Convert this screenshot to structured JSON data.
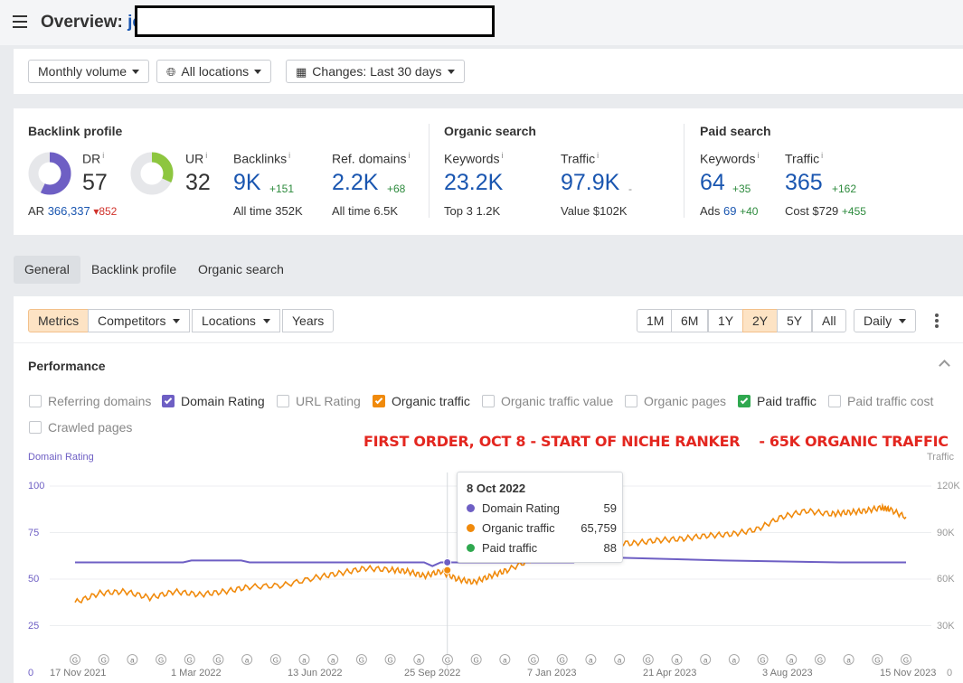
{
  "header": {
    "title": "Overview:",
    "domain_visible": "je"
  },
  "filters": {
    "volume": "Monthly volume",
    "locations": "All locations",
    "changes": "Changes: Last 30 days"
  },
  "backlink_profile": {
    "title": "Backlink profile",
    "dr": {
      "label": "DR",
      "value": "57",
      "fraction": 0.57
    },
    "ur": {
      "label": "UR",
      "value": "32",
      "fraction": 0.32
    },
    "ar_label": "AR",
    "ar_value": "366,337",
    "ar_delta": "▾852",
    "backlinks": {
      "label": "Backlinks",
      "value": "9K",
      "delta": "+151",
      "sub_label": "All time",
      "sub_value": "352K"
    },
    "ref_domains": {
      "label": "Ref. domains",
      "value": "2.2K",
      "delta": "+68",
      "sub_label": "All time",
      "sub_value": "6.5K"
    }
  },
  "organic_search": {
    "title": "Organic search",
    "keywords": {
      "label": "Keywords",
      "value": "23.2K",
      "sub_label": "Top 3",
      "sub_value": "1.2K"
    },
    "traffic": {
      "label": "Traffic",
      "value": "97.9K",
      "delta": "-",
      "sub_label": "Value",
      "sub_value": "$102K"
    }
  },
  "paid_search": {
    "title": "Paid search",
    "keywords": {
      "label": "Keywords",
      "value": "64",
      "delta": "+35",
      "sub_label": "Ads",
      "sub_value": "69",
      "sub_delta": "+40"
    },
    "traffic": {
      "label": "Traffic",
      "value": "365",
      "delta": "+162",
      "sub_label": "Cost",
      "sub_value": "$729",
      "sub_delta": "+455"
    }
  },
  "info_mark": "i",
  "tabs": [
    "General",
    "Backlink profile",
    "Organic search"
  ],
  "toolbar": {
    "metrics": "Metrics",
    "competitors": "Competitors",
    "locations": "Locations",
    "years": "Years",
    "ranges": [
      "1M",
      "6M",
      "1Y",
      "2Y",
      "5Y",
      "All"
    ],
    "active_range": "2Y",
    "interval": "Daily"
  },
  "performance": {
    "title": "Performance",
    "checkboxes": [
      {
        "label": "Referring domains",
        "checked": false
      },
      {
        "label": "Domain Rating",
        "checked": true,
        "color": "#6e5fc4"
      },
      {
        "label": "URL Rating",
        "checked": false
      },
      {
        "label": "Organic traffic",
        "checked": true,
        "color": "#f08a0c"
      },
      {
        "label": "Organic traffic value",
        "checked": false
      },
      {
        "label": "Organic pages",
        "checked": false
      },
      {
        "label": "Paid traffic",
        "checked": true,
        "color": "#2fa84f"
      },
      {
        "label": "Paid traffic cost",
        "checked": false
      },
      {
        "label": "Crawled pages",
        "checked": false
      }
    ],
    "annotation": "FIRST ORDER, OCT 8 - START OF NICHE RANKER    - 65K ORGANIC TRAFFIC"
  },
  "tooltip": {
    "date": "8 Oct 2022",
    "rows": [
      {
        "label": "Domain Rating",
        "value": "59",
        "color": "#6e5fc4"
      },
      {
        "label": "Organic traffic",
        "value": "65,759",
        "color": "#f08a0c"
      },
      {
        "label": "Paid traffic",
        "value": "88",
        "color": "#2fa84f"
      }
    ]
  },
  "chart_data": {
    "type": "line",
    "left_axis_label": "Domain Rating",
    "right_axis_label": "Traffic",
    "left_ticks": [
      "100",
      "75",
      "50",
      "25",
      "0"
    ],
    "right_ticks": [
      "120K",
      "90K",
      "60K",
      "30K",
      "0"
    ],
    "x_ticks": [
      "17 Nov 2021",
      "1 Mar 2022",
      "13 Jun 2022",
      "25 Sep 2022",
      "7 Jan 2023",
      "21 Apr 2023",
      "3 Aug 2023",
      "15 Nov 2023"
    ],
    "ylim_left": [
      0,
      100
    ],
    "ylim_right": [
      0,
      120000
    ],
    "series": [
      {
        "name": "Domain Rating",
        "color": "#6e5fc4",
        "axis": "left",
        "points": [
          [
            0,
            59
          ],
          [
            0.13,
            59
          ],
          [
            0.14,
            60
          ],
          [
            0.2,
            60
          ],
          [
            0.21,
            59
          ],
          [
            0.42,
            59
          ],
          [
            0.43,
            57
          ],
          [
            0.44,
            59
          ],
          [
            0.6,
            59
          ],
          [
            0.61,
            62
          ],
          [
            0.78,
            60
          ],
          [
            0.92,
            59
          ],
          [
            1,
            59
          ]
        ]
      },
      {
        "name": "Organic traffic",
        "color": "#f08a0c",
        "axis": "right",
        "points": [
          [
            0,
            45000
          ],
          [
            0.03,
            51000
          ],
          [
            0.06,
            52000
          ],
          [
            0.09,
            48000
          ],
          [
            0.12,
            52000
          ],
          [
            0.15,
            50000
          ],
          [
            0.18,
            52000
          ],
          [
            0.21,
            55000
          ],
          [
            0.25,
            56000
          ],
          [
            0.29,
            61000
          ],
          [
            0.32,
            64000
          ],
          [
            0.35,
            67000
          ],
          [
            0.38,
            66000
          ],
          [
            0.4,
            65000
          ],
          [
            0.42,
            62000
          ],
          [
            0.44,
            65000
          ],
          [
            0.46,
            60000
          ],
          [
            0.48,
            58000
          ],
          [
            0.5,
            62000
          ],
          [
            0.52,
            65759
          ],
          [
            0.55,
            73000
          ],
          [
            0.58,
            80000
          ],
          [
            0.61,
            84000
          ],
          [
            0.64,
            84000
          ],
          [
            0.67,
            83000
          ],
          [
            0.7,
            85000
          ],
          [
            0.73,
            86000
          ],
          [
            0.76,
            88000
          ],
          [
            0.79,
            89000
          ],
          [
            0.82,
            92000
          ],
          [
            0.85,
            100000
          ],
          [
            0.88,
            104000
          ],
          [
            0.91,
            102000
          ],
          [
            0.93,
            103000
          ],
          [
            0.95,
            104000
          ],
          [
            0.97,
            106000
          ],
          [
            0.98,
            105000
          ],
          [
            1,
            100000
          ]
        ]
      },
      {
        "name": "Paid traffic",
        "color": "#2fa84f",
        "axis": "right",
        "points": [
          [
            0,
            400
          ],
          [
            0.25,
            380
          ],
          [
            0.5,
            350
          ],
          [
            0.75,
            340
          ],
          [
            1,
            365
          ]
        ]
      }
    ],
    "highlight": {
      "date": "8 Oct 2022",
      "dr": 59,
      "organic": 65759,
      "paid": 88
    },
    "event_markers": [
      "G",
      "G",
      "a",
      "G",
      "G",
      "G",
      "a",
      "G",
      "a",
      "a",
      "G",
      "G",
      "a",
      "G",
      "G",
      "a",
      "G",
      "G",
      "a",
      "a",
      "G",
      "a",
      "a",
      "a",
      "G",
      "a",
      "G",
      "a",
      "G",
      "G"
    ]
  }
}
